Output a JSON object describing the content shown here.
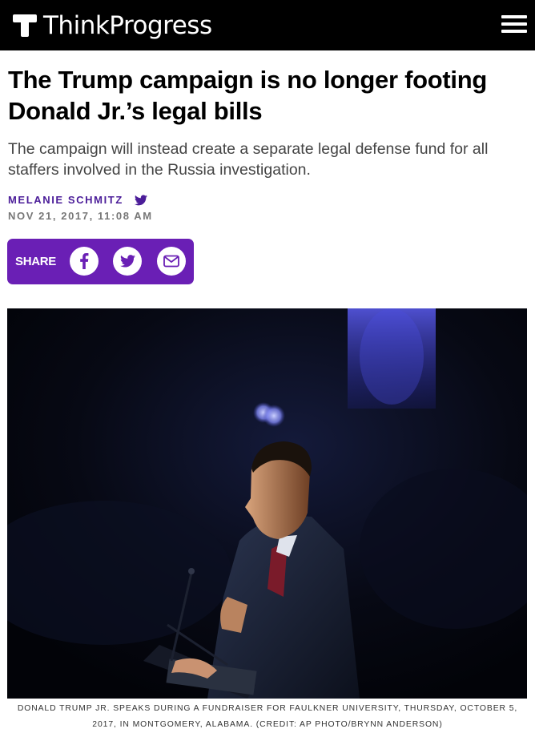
{
  "site": {
    "name": "ThinkProgress",
    "logo_icon": "thinkprogress-t-logo",
    "menu_icon": "hamburger-menu-icon"
  },
  "article": {
    "headline": "The Trump campaign is no longer footing Donald Jr.’s legal bills",
    "dek": "The campaign will instead create a separate legal defense fund for all staffers involved in the Russia investigation.",
    "author": "MELANIE SCHMITZ",
    "author_social_icon": "twitter-icon",
    "date": "NOV 21, 2017, 11:08 AM"
  },
  "share": {
    "label": "SHARE",
    "buttons": [
      {
        "icon": "facebook-icon"
      },
      {
        "icon": "twitter-icon"
      },
      {
        "icon": "email-icon"
      }
    ],
    "background_color": "#6a1fb5"
  },
  "photo": {
    "caption": "DONALD TRUMP JR. SPEAKS DURING A FUNDRAISER FOR FAULKNER UNIVERSITY, THURSDAY, OCTOBER 5, 2017, IN MONTGOMERY, ALABAMA. (CREDIT: AP PHOTO/BRYNN ANDERSON)"
  },
  "colors": {
    "header_bg": "#000000",
    "author": "#4b1d99",
    "date": "#777777"
  }
}
